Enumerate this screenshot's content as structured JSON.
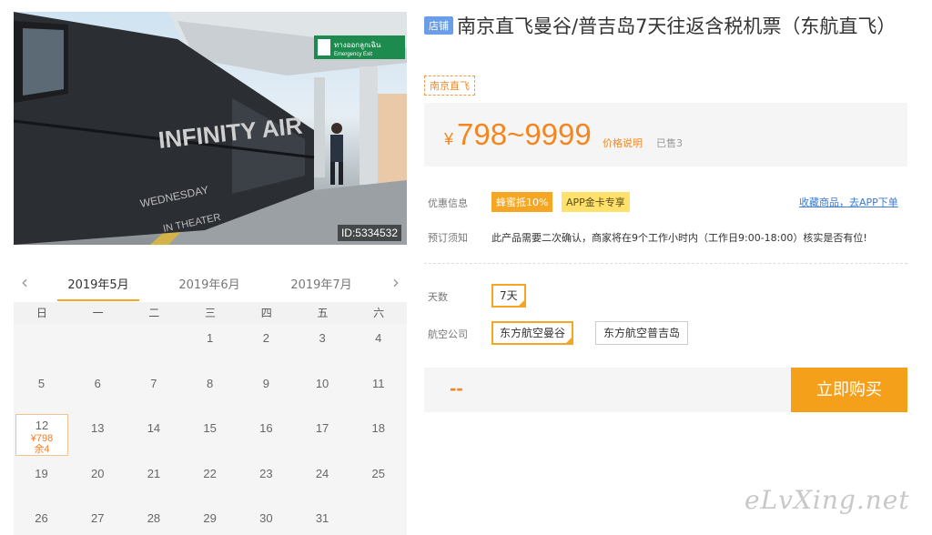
{
  "photo": {
    "id_label": "ID:5334532",
    "sign_text": "ทางออกลูกเฉิน",
    "sign_sub": "Emergency Exit",
    "train_text": "INFINITY AIR",
    "train_text2": "WEDNESDAY",
    "train_text3": "IN THEATER"
  },
  "calendar": {
    "prev_icon": "chevron-left-icon",
    "next_icon": "chevron-right-icon",
    "months": [
      "2019年5月",
      "2019年6月",
      "2019年7月"
    ],
    "active_month": "2019年5月",
    "weekdays": [
      "日",
      "一",
      "二",
      "三",
      "四",
      "五",
      "六"
    ],
    "weeks": [
      [
        "",
        "",
        "",
        "1",
        "2",
        "3",
        "4"
      ],
      [
        "5",
        "6",
        "7",
        "8",
        "9",
        "10",
        "11"
      ],
      [
        "12",
        "13",
        "14",
        "15",
        "16",
        "17",
        "18"
      ],
      [
        "19",
        "20",
        "21",
        "22",
        "23",
        "24",
        "25"
      ],
      [
        "26",
        "27",
        "28",
        "29",
        "30",
        "31",
        ""
      ]
    ],
    "selected_day": {
      "day": "12",
      "price": "¥798",
      "stock": "余4"
    }
  },
  "product": {
    "shop_badge": "店铺",
    "title": "南京直飞曼谷/普吉岛7天往返含税机票（东航直飞）",
    "tag": "南京直飞",
    "currency": "¥",
    "price_range": "798~9999",
    "price_note": "价格说明",
    "sold": "已售3"
  },
  "promo": {
    "label": "优惠信息",
    "discount_tag": "蜂蜜抵10%",
    "vip_tag": "APP金卡专享",
    "fav_link": "收藏商品，去APP下单"
  },
  "notice": {
    "label": "预订须知",
    "text": "此产品需要二次确认，商家将在9个工作小时内（工作日9:00-18:00）核实是否有位!"
  },
  "options": {
    "days_label": "天数",
    "days_value": "7天",
    "airline_label": "航空公司",
    "airline_1": "东方航空曼谷",
    "airline_2": "东方航空普吉岛"
  },
  "purchase": {
    "total": "--",
    "buy_label": "立即购买"
  },
  "watermark": "eLvXing.net",
  "colors": {
    "accent": "#f5a623",
    "price": "#f5861f",
    "link": "#3a7bd5",
    "badge": "#6b9ee8"
  }
}
